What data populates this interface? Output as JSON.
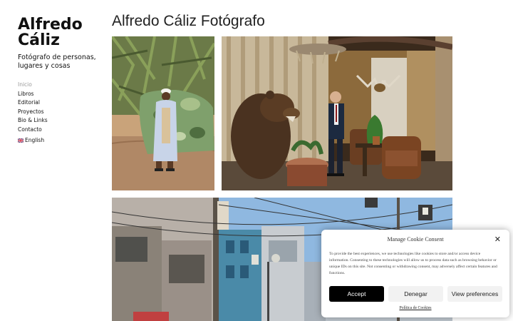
{
  "site": {
    "brand_line1": "Alfredo",
    "brand_line2": "Cáliz",
    "tagline": "Fotógrafo de personas, lugares y cosas"
  },
  "nav": {
    "items": [
      {
        "label": "Inicio",
        "active": true
      },
      {
        "label": "Libros"
      },
      {
        "label": "Editorial"
      },
      {
        "label": "Proyectos"
      },
      {
        "label": "Bio & Links"
      },
      {
        "label": "Contacto"
      }
    ],
    "language": {
      "label": "English",
      "flag_icon": "uk-flag-icon"
    }
  },
  "page": {
    "title": "Alfredo Cáliz Fotógrafo"
  },
  "cookie": {
    "title": "Manage Cookie Consent",
    "close_icon": "close-icon",
    "text": "To provide the best experiences, we use technologies like cookies to store and/or access device information. Consenting to these technologies will allow us to process data such as browsing behavior or unique IDs on this site. Not consenting or withdrawing consent, may adversely affect certain features and functions.",
    "accept": "Accept",
    "deny": "Denegar",
    "preferences": "View preferences",
    "policy": "Política de Cookies"
  },
  "colors": {
    "accent_button": "#000000",
    "secondary_button": "#f2f2f2",
    "inactive_nav": "#999999"
  }
}
